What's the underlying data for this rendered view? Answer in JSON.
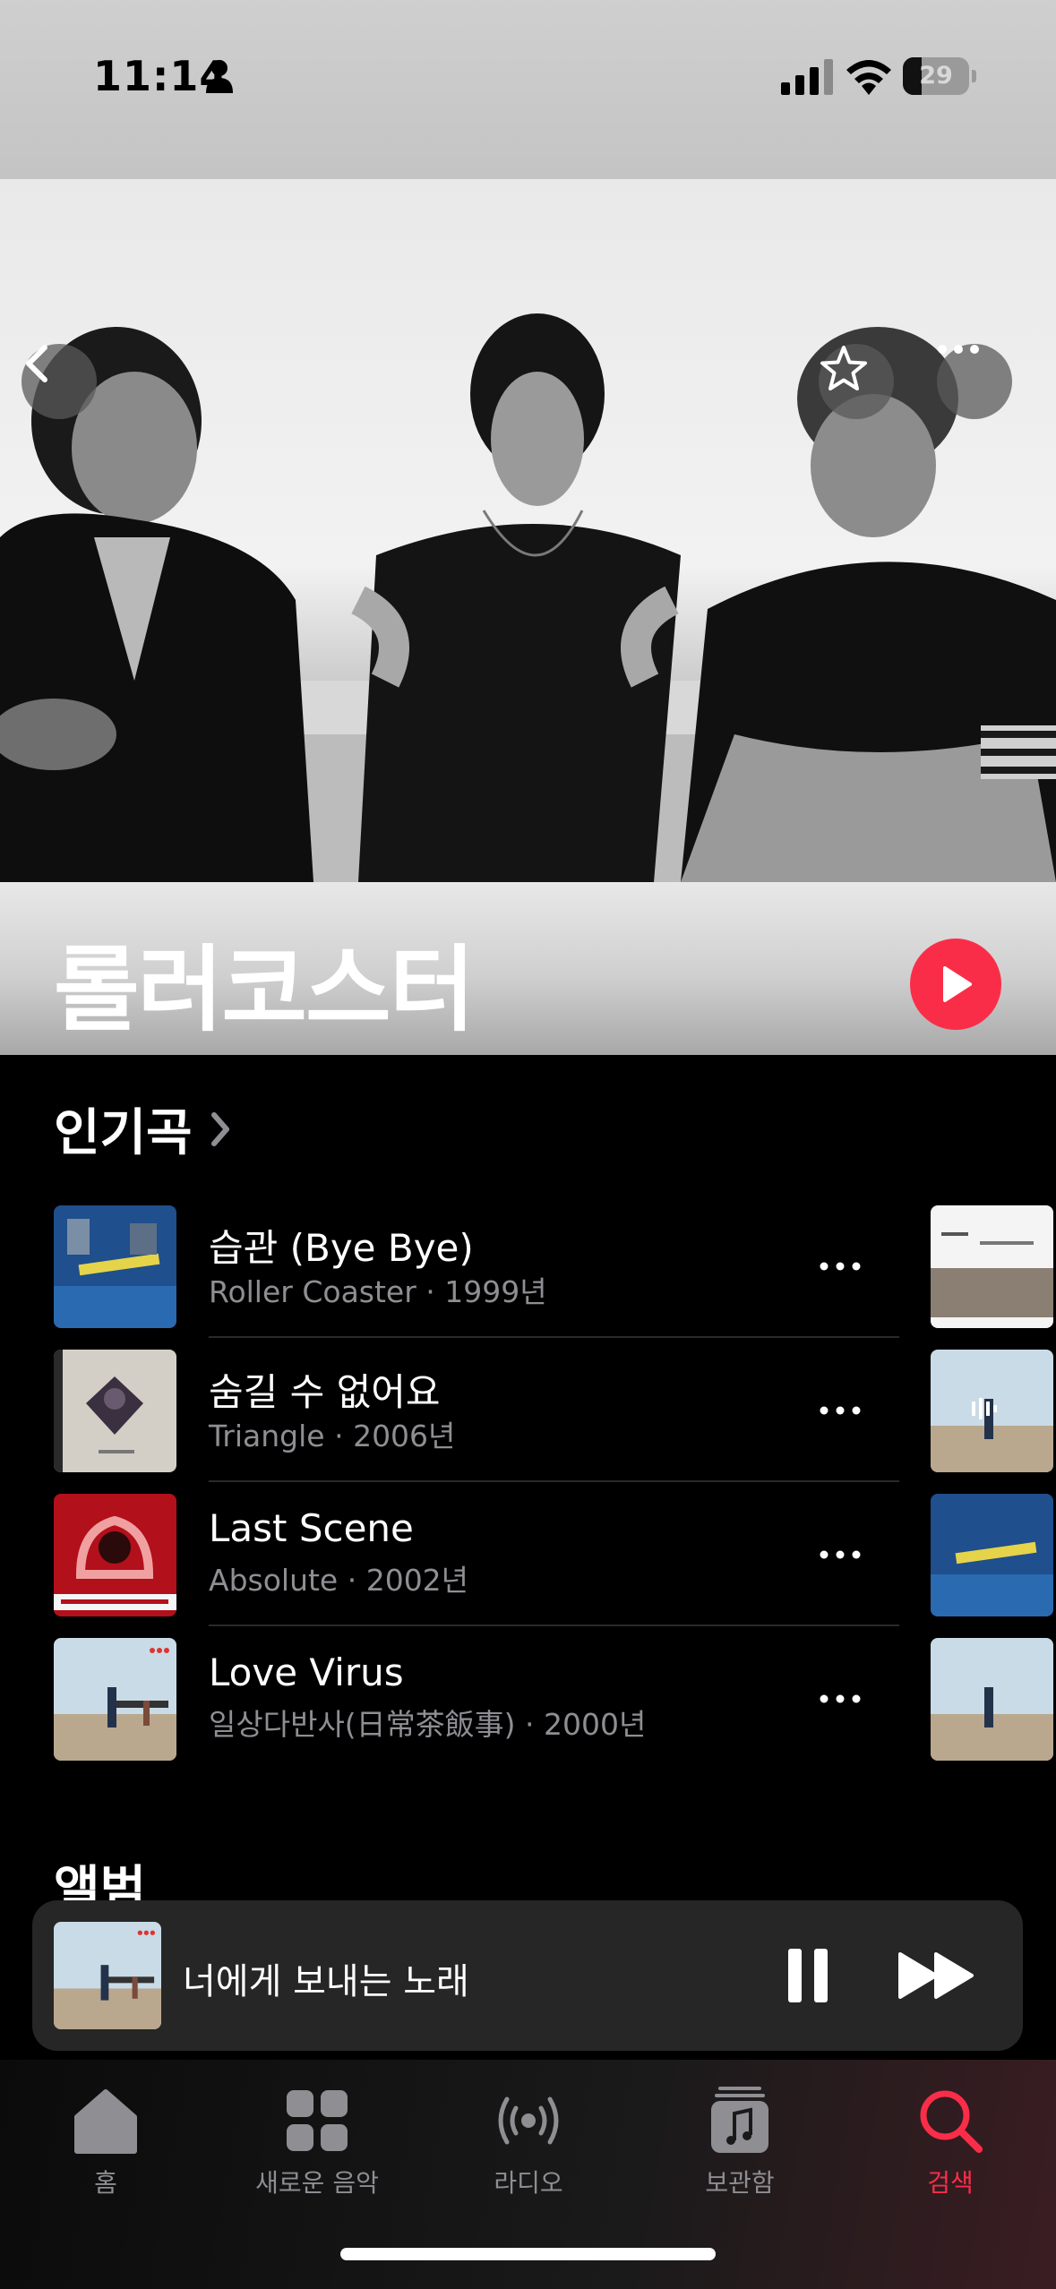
{
  "status_bar": {
    "time": "11:14",
    "battery": "29",
    "battery_level": 0.29
  },
  "artist": {
    "name": "롤러코스터"
  },
  "top_songs": {
    "title": "인기곡",
    "items": [
      {
        "title": "습관 (Bye Bye)",
        "subtitle": "Roller Coaster · 1999년"
      },
      {
        "title": "숨길 수 없어요",
        "subtitle": "Triangle · 2006년"
      },
      {
        "title": "Last Scene",
        "subtitle": "Absolute · 2002년"
      },
      {
        "title": "Love Virus",
        "subtitle": "일상다반사(日常茶飯事) · 2000년"
      }
    ]
  },
  "albums": {
    "title": "앨범"
  },
  "now_playing": {
    "title": "너에게 보내는 노래"
  },
  "tabs": [
    {
      "label": "홈",
      "icon": "home-icon"
    },
    {
      "label": "새로운 음악",
      "icon": "grid-icon"
    },
    {
      "label": "라디오",
      "icon": "radio-icon"
    },
    {
      "label": "보관함",
      "icon": "library-icon"
    },
    {
      "label": "검색",
      "icon": "search-icon",
      "active": true
    }
  ],
  "colors": {
    "accent": "#fa2d48",
    "inactive_tab": "#8e8e93"
  }
}
